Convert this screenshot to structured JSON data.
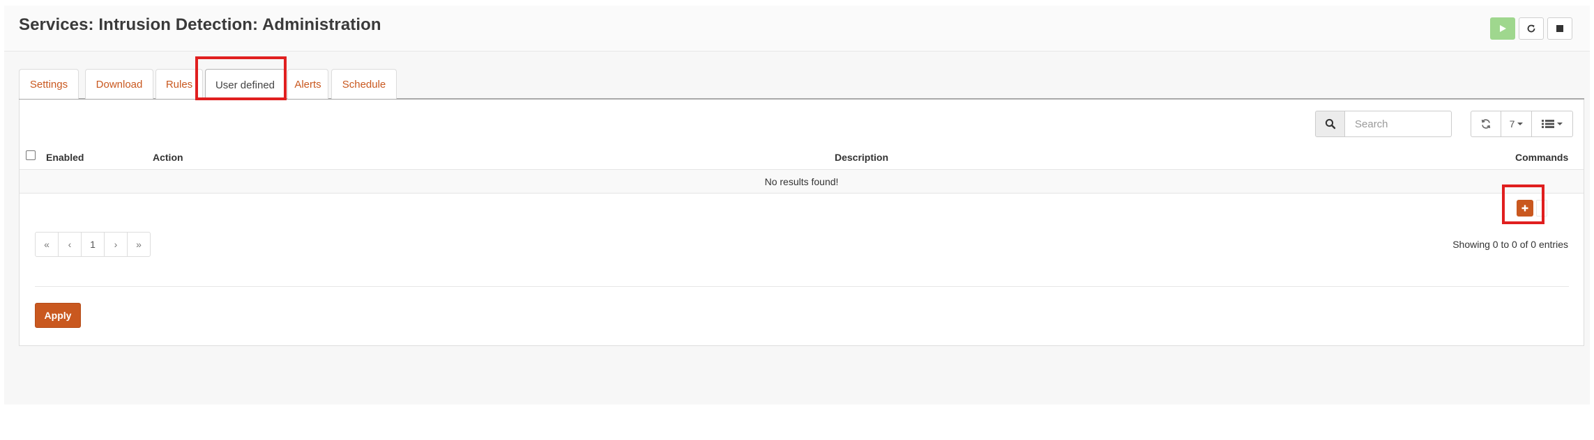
{
  "page": {
    "title": "Services: Intrusion Detection: Administration"
  },
  "service_controls": [
    {
      "name": "play-icon",
      "color": "#9fd78e"
    },
    {
      "name": "restart-icon"
    },
    {
      "name": "stop-icon"
    }
  ],
  "tabs": [
    {
      "label": "Settings"
    },
    {
      "label": "Download"
    },
    {
      "label": "Rules"
    },
    {
      "label": "User defined",
      "active": true
    },
    {
      "label": "Alerts"
    },
    {
      "label": "Schedule"
    }
  ],
  "toolbar": {
    "search_placeholder": "Search",
    "page_size": "7",
    "refresh_icon": "refresh-icon",
    "columns_icon": "list-icon"
  },
  "grid": {
    "columns": [
      "Enabled",
      "Action",
      "Description",
      "Commands"
    ],
    "empty_message": "No results found!"
  },
  "pagination": {
    "first": "«",
    "prev": "‹",
    "page": "1",
    "next": "›",
    "last": "»",
    "summary": "Showing 0 to 0 of 0 entries"
  },
  "actions": {
    "apply_label": "Apply"
  },
  "colors": {
    "accent": "#c9581f",
    "highlight": "#e01f1f"
  }
}
